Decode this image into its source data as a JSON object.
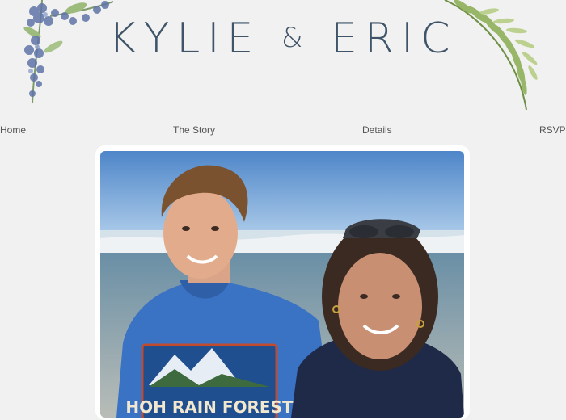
{
  "site": {
    "title_name_1": "KYLIE",
    "title_ampersand": "&",
    "title_name_2": "ERIC"
  },
  "nav": {
    "items": [
      {
        "label": "Home"
      },
      {
        "label": "The Story"
      },
      {
        "label": "Details"
      },
      {
        "label": "RSVP"
      }
    ]
  },
  "photo": {
    "shirt_text": "HOH RAIN FOREST"
  },
  "colors": {
    "background": "#f1f1f1",
    "title": "#3f5468",
    "nav_text": "#555555",
    "frame": "#ffffff"
  },
  "decorations": {
    "left": "blue-hydrangea-floral",
    "right": "green-fern-leaf"
  }
}
